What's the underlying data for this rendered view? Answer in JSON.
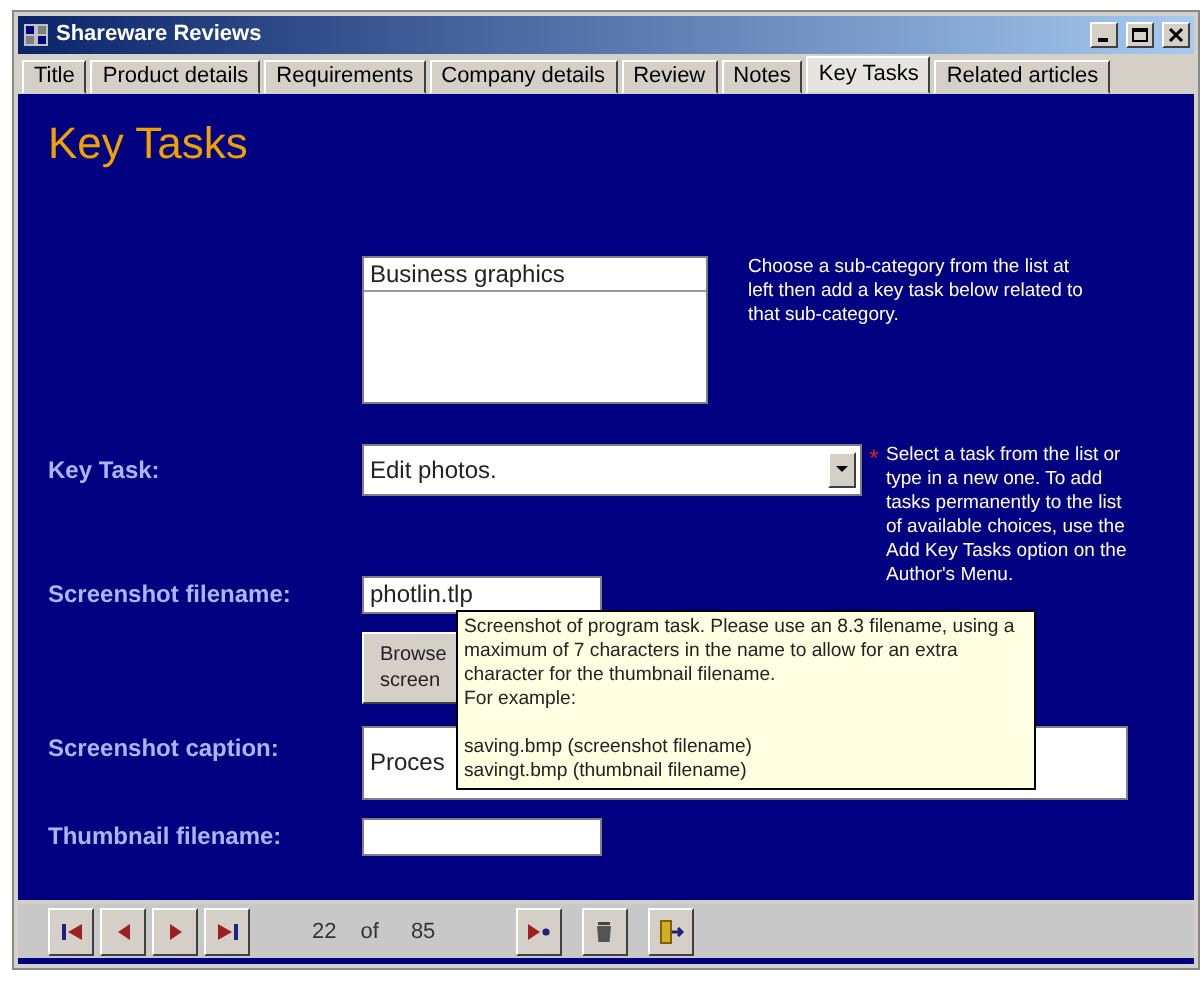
{
  "window": {
    "title": "Shareware Reviews"
  },
  "tabs": [
    {
      "label": "Title",
      "selected": false
    },
    {
      "label": "Product details",
      "selected": false
    },
    {
      "label": "Requirements",
      "selected": false
    },
    {
      "label": "Company details",
      "selected": false
    },
    {
      "label": "Review",
      "selected": false
    },
    {
      "label": "Notes",
      "selected": false
    },
    {
      "label": "Key Tasks",
      "selected": true
    },
    {
      "label": "Related articles",
      "selected": false
    }
  ],
  "heading": "Key Tasks",
  "subcategory_list": {
    "items": [
      "Business graphics"
    ],
    "hint": "Choose a sub-category from the list at left then add a key task below related to that sub-category."
  },
  "key_task": {
    "label": "Key Task:",
    "value": "Edit photos.",
    "required_mark": "*",
    "hint": "Select a task from the list or type in a new one. To add tasks permanently to the list of available choices, use the Add Key Tasks option on the Author's Menu."
  },
  "screenshot_filename": {
    "label": "Screenshot filename:",
    "value": "photlin.tlp"
  },
  "browse_button": {
    "label": "Browse screen"
  },
  "screenshot_caption": {
    "label": "Screenshot caption:",
    "value": "Proces"
  },
  "thumbnail_filename": {
    "label": "Thumbnail filename:"
  },
  "tooltip": {
    "paragraphs": [
      "Screenshot of program task. Please use an 8.3 filename, using a maximum of 7 characters in the name to allow for an extra character for the thumbnail filename.",
      "For example:",
      "saving.bmp (screenshot filename)",
      "savingt.bmp (thumbnail filename)"
    ]
  },
  "navigator": {
    "current": "22",
    "of": "of",
    "total": "85"
  }
}
